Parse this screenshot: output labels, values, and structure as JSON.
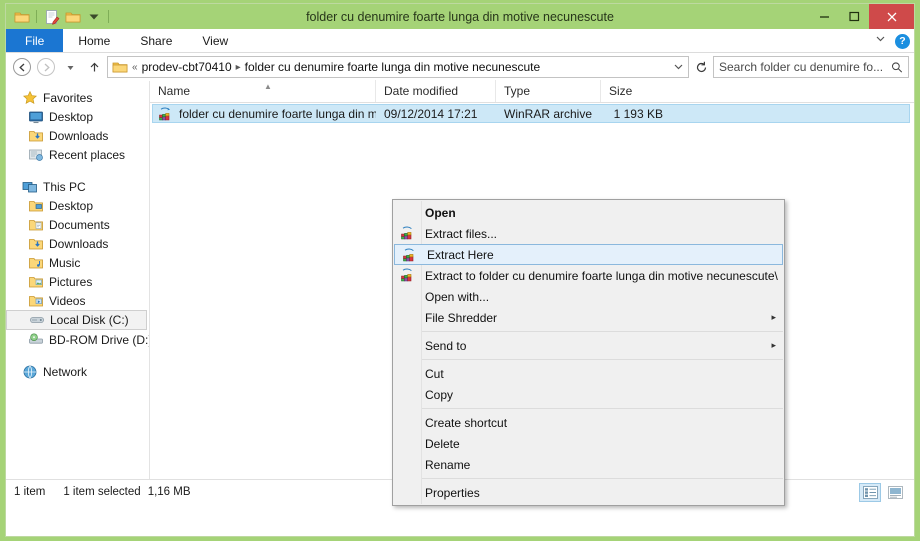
{
  "window": {
    "title": "folder cu denumire foarte lunga din motive necunescute",
    "minimize_label": "minimize-icon",
    "maximize_label": "maximize-icon",
    "close_label": "×"
  },
  "quick_access": {
    "items": [
      {
        "name": "folder-icon",
        "label": ""
      },
      {
        "name": "properties-icon",
        "label": ""
      },
      {
        "name": "new-folder-icon",
        "label": ""
      },
      {
        "name": "chevron-down-icon",
        "label": "▾"
      }
    ]
  },
  "ribbon": {
    "tabs": [
      {
        "label": "File",
        "active": true
      },
      {
        "label": "Home",
        "active": false
      },
      {
        "label": "Share",
        "active": false
      },
      {
        "label": "View",
        "active": false
      }
    ],
    "expand_icon": "⌄",
    "help_icon": "?"
  },
  "address": {
    "back_icon": "←",
    "forward_icon": "→",
    "recent_icon": "▾",
    "up_icon": "↑",
    "overflow": "«",
    "crumbs": [
      "prodev-cbt70410",
      "folder cu denumire foarte lunga din motive necunescute"
    ],
    "separator": "▸",
    "dropdown_icon": "⌄",
    "refresh_icon": "↻"
  },
  "search": {
    "placeholder": "Search folder cu denumire fo...",
    "value": "",
    "icon": "search-icon"
  },
  "sidebar": {
    "groups": [
      {
        "header": {
          "label": "Favorites",
          "icon": "star-icon"
        },
        "items": [
          {
            "label": "Desktop",
            "icon": "desktop-icon"
          },
          {
            "label": "Downloads",
            "icon": "downloads-folder-icon"
          },
          {
            "label": "Recent places",
            "icon": "recent-places-icon"
          }
        ]
      },
      {
        "header": {
          "label": "This PC",
          "icon": "computer-icon"
        },
        "items": [
          {
            "label": "Desktop",
            "icon": "desktop-folder-icon"
          },
          {
            "label": "Documents",
            "icon": "documents-folder-icon"
          },
          {
            "label": "Downloads",
            "icon": "downloads-folder-icon"
          },
          {
            "label": "Music",
            "icon": "music-folder-icon"
          },
          {
            "label": "Pictures",
            "icon": "pictures-folder-icon"
          },
          {
            "label": "Videos",
            "icon": "videos-folder-icon"
          },
          {
            "label": "Local Disk (C:)",
            "icon": "hard-drive-icon",
            "selected": true
          },
          {
            "label": "BD-ROM Drive (D:) H",
            "icon": "optical-drive-icon"
          }
        ]
      },
      {
        "header": {
          "label": "Network",
          "icon": "network-icon"
        },
        "items": []
      }
    ]
  },
  "filelist": {
    "columns": [
      {
        "label": "Name",
        "sorted": true,
        "sort_icon": "▲"
      },
      {
        "label": "Date modified"
      },
      {
        "label": "Type"
      },
      {
        "label": "Size"
      }
    ],
    "rows": [
      {
        "name": "folder cu denumire foarte lunga din moti",
        "date_modified": "09/12/2014 17:21",
        "type": "WinRAR archive",
        "size": "1 193 KB",
        "icon": "winrar-archive-icon",
        "selected": true
      }
    ]
  },
  "context_menu": {
    "items": [
      {
        "label": "Open",
        "bold": true,
        "icon": null,
        "submenu": false
      },
      {
        "label": "Extract files...",
        "icon": "winrar-archive-icon",
        "submenu": false
      },
      {
        "label": "Extract Here",
        "icon": "winrar-archive-icon",
        "submenu": false,
        "highlighted": true
      },
      {
        "label": "Extract to folder cu denumire foarte lunga din motive necunescute\\",
        "icon": "winrar-archive-icon",
        "submenu": false
      },
      {
        "label": "Open with...",
        "icon": null,
        "submenu": false
      },
      {
        "label": "File Shredder",
        "icon": null,
        "submenu": true,
        "arrow": "▸"
      },
      {
        "separator": true
      },
      {
        "label": "Send to",
        "icon": null,
        "submenu": true,
        "arrow": "▸"
      },
      {
        "separator": true
      },
      {
        "label": "Cut",
        "icon": null,
        "submenu": false
      },
      {
        "label": "Copy",
        "icon": null,
        "submenu": false
      },
      {
        "separator": true
      },
      {
        "label": "Create shortcut",
        "icon": null,
        "submenu": false
      },
      {
        "label": "Delete",
        "icon": null,
        "submenu": false
      },
      {
        "label": "Rename",
        "icon": null,
        "submenu": false
      },
      {
        "separator": true
      },
      {
        "label": "Properties",
        "icon": null,
        "submenu": false
      }
    ]
  },
  "statusbar": {
    "item_count": "1 item",
    "selection": "1 item selected",
    "selection_size": "1,16 MB",
    "views": [
      {
        "name": "details-view-button",
        "active": true
      },
      {
        "name": "large-icons-view-button",
        "active": false
      }
    ]
  },
  "colors": {
    "desktop": "#a5d377",
    "titlebar": "#a5d377",
    "accent": "#1b76d2",
    "close": "#cf4a4a",
    "selection": "#cde8f7",
    "menu_highlight": "#e4f0fb"
  }
}
